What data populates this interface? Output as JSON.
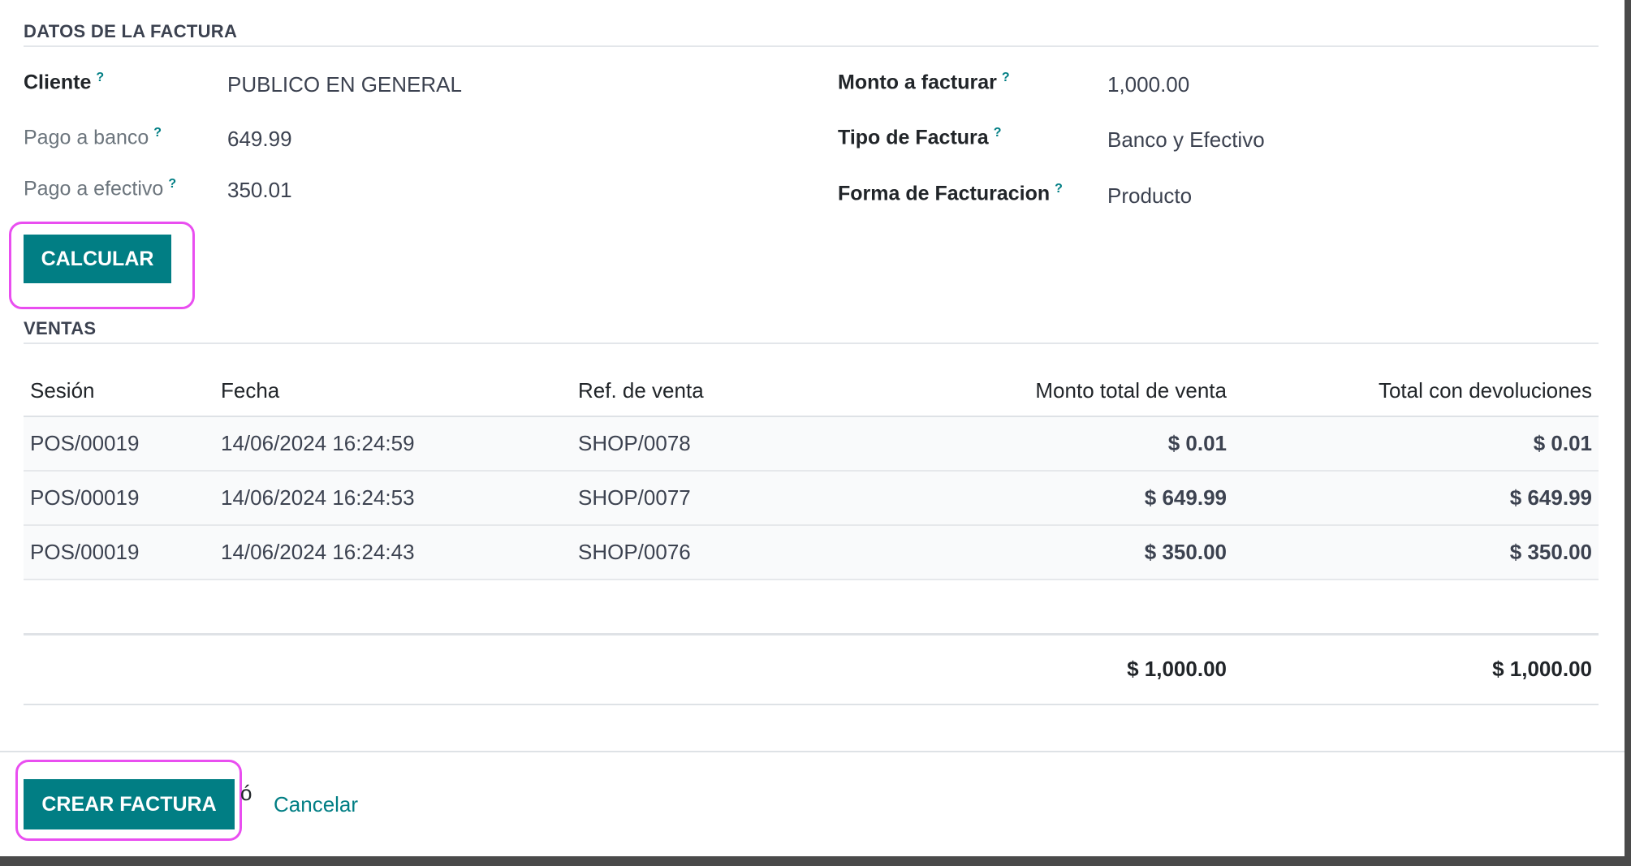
{
  "invoice_section": {
    "title": "DATOS DE LA FACTURA",
    "help_mark": "?",
    "cliente_label": "Cliente",
    "cliente_value": "PUBLICO EN GENERAL",
    "pago_banco_label": "Pago a banco",
    "pago_banco_value": "649.99",
    "pago_efectivo_label": "Pago a efectivo",
    "pago_efectivo_value": "350.01",
    "monto_label": "Monto a facturar",
    "monto_value": "1,000.00",
    "tipo_label": "Tipo de Factura",
    "tipo_value": "Banco y Efectivo",
    "forma_label": "Forma de Facturacion",
    "forma_value": "Producto",
    "calcular_button": "CALCULAR"
  },
  "sales_section": {
    "title": "VENTAS",
    "columns": [
      "Sesión",
      "Fecha",
      "Ref. de venta",
      "Monto total de venta",
      "Total con devoluciones"
    ],
    "rows": [
      {
        "session": "POS/00019",
        "date": "14/06/2024 16:24:59",
        "ref": "SHOP/0078",
        "total": "$ 0.01",
        "total_returns": "$ 0.01"
      },
      {
        "session": "POS/00019",
        "date": "14/06/2024 16:24:53",
        "ref": "SHOP/0077",
        "total": "$ 649.99",
        "total_returns": "$ 649.99"
      },
      {
        "session": "POS/00019",
        "date": "14/06/2024 16:24:43",
        "ref": "SHOP/0076",
        "total": "$ 350.00",
        "total_returns": "$ 350.00"
      }
    ],
    "totals": {
      "total": "$ 1,000.00",
      "total_returns": "$ 1,000.00"
    }
  },
  "footer": {
    "create_button": "CREAR FACTURA",
    "stray_char": "ó",
    "cancel_link": "Cancelar"
  },
  "colors": {
    "primary": "#017e84",
    "highlight": "#e94ef0"
  }
}
